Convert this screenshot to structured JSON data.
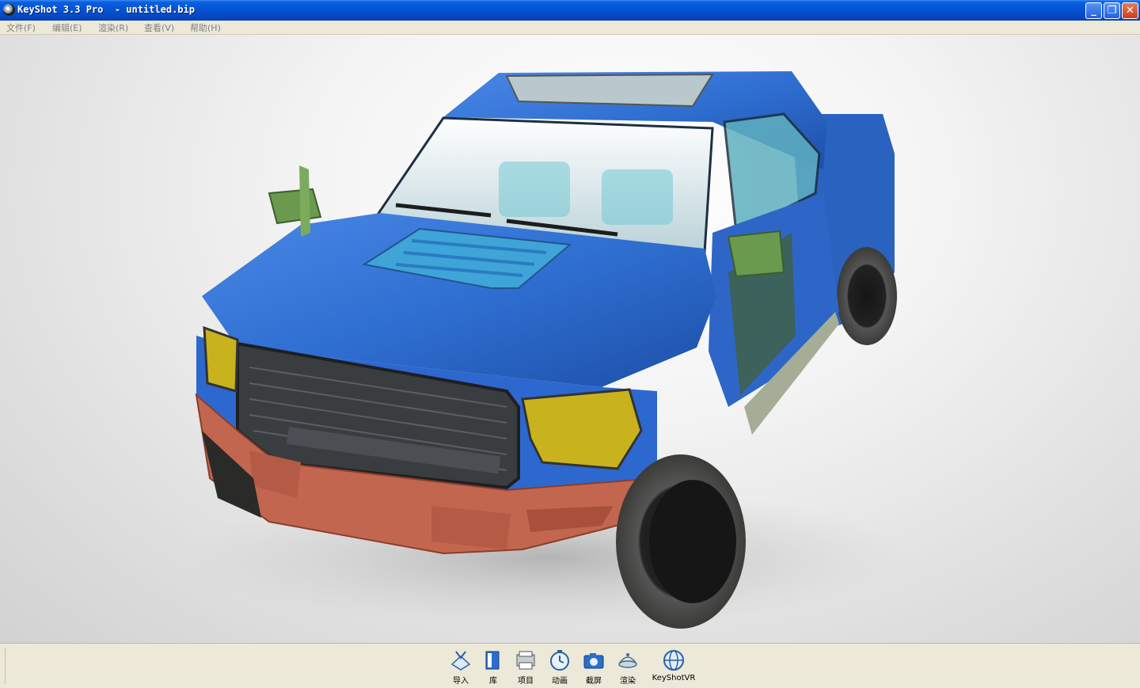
{
  "window": {
    "title": "KeyShot 3.3 Pro  - untitled.bip",
    "minimize_symbol": "_",
    "restore_symbol": "❐",
    "close_symbol": "✕"
  },
  "menu": {
    "items": [
      {
        "label": "文件(F)"
      },
      {
        "label": "编辑(E)"
      },
      {
        "label": "渲染(R)"
      },
      {
        "label": "查看(V)"
      },
      {
        "label": "帮助(H)"
      }
    ]
  },
  "viewport": {
    "scene": "pickup-truck-render",
    "colors": {
      "body": "#2f6fd1",
      "grille": "#3a3d40",
      "bumper": "#c2664f",
      "mirror": "#6a9a4e",
      "headlight": "#c8b21e",
      "tire": "#2a2a28",
      "glass": "#cfe3e8"
    }
  },
  "toolbar": {
    "buttons": [
      {
        "label": "导入",
        "icon": "import-icon"
      },
      {
        "label": "库",
        "icon": "library-icon"
      },
      {
        "label": "项目",
        "icon": "project-icon"
      },
      {
        "label": "动画",
        "icon": "animation-icon"
      },
      {
        "label": "截屏",
        "icon": "screenshot-icon"
      },
      {
        "label": "渲染",
        "icon": "render-icon"
      },
      {
        "label": "KeyShotVR",
        "icon": "keyshotvr-icon"
      }
    ]
  }
}
